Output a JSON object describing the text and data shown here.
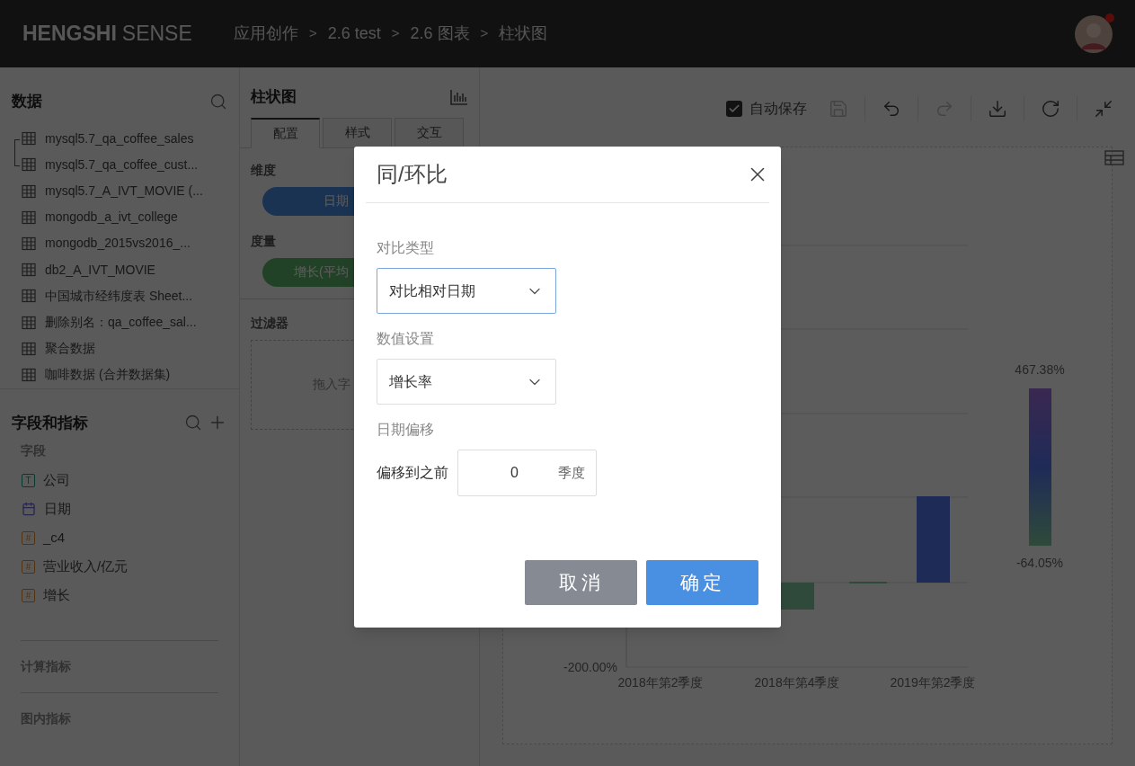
{
  "topbar": {
    "logo_bold": "HENGSHI",
    "logo_light": "SENSE",
    "breadcrumb": [
      {
        "kind": "link",
        "text": "应用创作"
      },
      {
        "kind": "separator",
        "text": ">"
      },
      {
        "kind": "link",
        "text": "2.6 test"
      },
      {
        "kind": "separator",
        "text": ">"
      },
      {
        "kind": "link",
        "text": "2.6 图表"
      },
      {
        "kind": "separator",
        "text": ">"
      },
      {
        "kind": "link",
        "text": "柱状图"
      }
    ],
    "notification": true
  },
  "data_panel": {
    "title": "数据",
    "items": [
      {
        "name": "mysql5.7_qa_coffee_sales",
        "linked": true
      },
      {
        "name": "mysql5.7_qa_coffee_cust...",
        "linked": true
      },
      {
        "name": "mysql5.7_A_IVT_MOVIE (...",
        "linked": false
      },
      {
        "name": "mongodb_a_ivt_college",
        "linked": false
      },
      {
        "name": "mongodb_2015vs2016_...",
        "linked": false
      },
      {
        "name": "db2_A_IVT_MOVIE",
        "linked": false
      },
      {
        "name": "中国城市经纬度表 Sheet...",
        "linked": false
      },
      {
        "name": "删除别名：qa_coffee_sal...",
        "linked": false
      },
      {
        "name": "聚合数据",
        "linked": false
      },
      {
        "name": "咖啡数据 (合并数据集)",
        "linked": false
      }
    ]
  },
  "fields_panel": {
    "title": "字段和指标",
    "fields_title": "字段",
    "fields": [
      {
        "kind": "text",
        "badge": "T",
        "name": "公司"
      },
      {
        "kind": "date",
        "name": "日期"
      },
      {
        "kind": "number",
        "badge": "#",
        "name": "_c4"
      },
      {
        "kind": "number",
        "badge": "#",
        "name": "营业收入/亿元"
      },
      {
        "kind": "number",
        "badge": "#",
        "name": "增长"
      }
    ],
    "sections": [
      "计算指标",
      "图内指标"
    ]
  },
  "config_panel": {
    "title": "柱状图",
    "tabs": [
      {
        "label": "配置",
        "selected": true
      },
      {
        "label": "样式",
        "selected": false
      },
      {
        "label": "交互",
        "selected": false
      }
    ],
    "dimension": {
      "label": "维度",
      "chip": "日期"
    },
    "measure": {
      "label": "度量",
      "chip": "增长(平均"
    },
    "filter": {
      "label": "过滤器",
      "hint": "拖入字"
    }
  },
  "toolbar": {
    "autosave": {
      "label": "自动保存",
      "checked": true
    },
    "buttons": [
      {
        "kind": "save",
        "disabled": true
      },
      {
        "kind": "undo",
        "disabled": false
      },
      {
        "kind": "redo",
        "disabled": true
      },
      {
        "kind": "download",
        "disabled": false
      },
      {
        "kind": "refresh",
        "disabled": false
      },
      {
        "kind": "collapse",
        "disabled": false
      }
    ]
  },
  "chart": {
    "y_tick_label": "-200.00%",
    "categories": [
      "2018年第2季度",
      "2018年第4季度",
      "2019年第2季度"
    ],
    "legend": {
      "max": "467.38%",
      "min": "-64.05%"
    }
  },
  "modal": {
    "title": "同/环比",
    "fields": [
      {
        "kind": "select",
        "label": "对比类型",
        "value": "对比相对日期",
        "focused": true
      },
      {
        "kind": "select",
        "label": "数值设置",
        "value": "增长率",
        "focused": false
      },
      {
        "kind": "offset",
        "label": "日期偏移",
        "prefix": "偏移到之前",
        "value": "0",
        "unit": "季度"
      }
    ],
    "buttons": [
      {
        "kind": "secondary",
        "label": "取消"
      },
      {
        "kind": "primary",
        "label": "确定"
      }
    ]
  }
}
